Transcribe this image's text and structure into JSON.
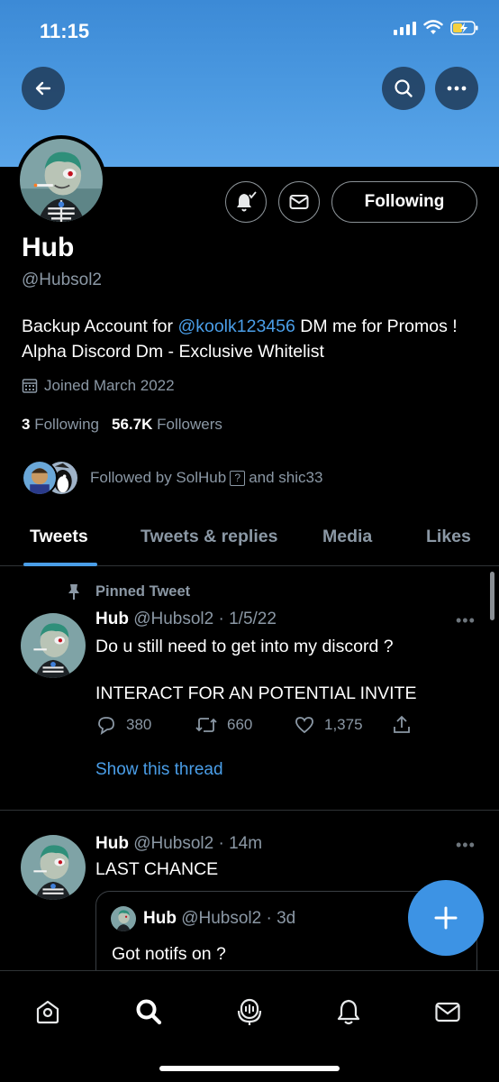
{
  "status_bar": {
    "time": "11:15"
  },
  "profile": {
    "name": "Hub",
    "handle": "@Hubsol2",
    "bio_prefix": "Backup Account for ",
    "bio_mention": "@koolk123456",
    "bio_suffix": " DM me for Promos ! Alpha Discord Dm - Exclusive Whitelist",
    "joined": "Joined March 2022",
    "following_count": "3",
    "following_label": "Following",
    "followers_count": "56.7K",
    "followers_label": "Followers",
    "followed_by_prefix": "Followed by SolHub",
    "followed_by_suffix": "and shic33",
    "following_button": "Following"
  },
  "tabs": [
    {
      "label": "Tweets",
      "active": true
    },
    {
      "label": "Tweets & replies",
      "active": false
    },
    {
      "label": "Media",
      "active": false
    },
    {
      "label": "Likes",
      "active": false
    }
  ],
  "tweets": [
    {
      "pinned_label": "Pinned Tweet",
      "name": "Hub",
      "handle_time": "@Hubsol2 · 1/5/22",
      "text_line1": "Do u still need to get into my discord ?",
      "text_line2": "INTERACT FOR AN  POTENTIAL INVITE",
      "replies": "380",
      "retweets": "660",
      "likes": "1,375",
      "show_thread": "Show this thread"
    },
    {
      "name": "Hub",
      "handle_time": "@Hubsol2 · 14m",
      "text": "LAST CHANCE",
      "quote": {
        "name": "Hub",
        "handle_time": "@Hubsol2 · 3d",
        "text": "Got notifs on ?"
      }
    }
  ],
  "colors": {
    "accent": "#4a9ee8",
    "banner": "#4d9be2",
    "background": "#000000",
    "muted_text": "#8b98a5"
  },
  "icons": [
    "back-arrow-icon",
    "search-icon",
    "more-icon",
    "bell-check-icon",
    "envelope-icon",
    "calendar-icon",
    "pin-icon",
    "reply-icon",
    "retweet-icon",
    "like-icon",
    "share-icon",
    "compose-plus-icon",
    "home-icon",
    "spaces-icon",
    "notifications-icon",
    "messages-icon"
  ]
}
